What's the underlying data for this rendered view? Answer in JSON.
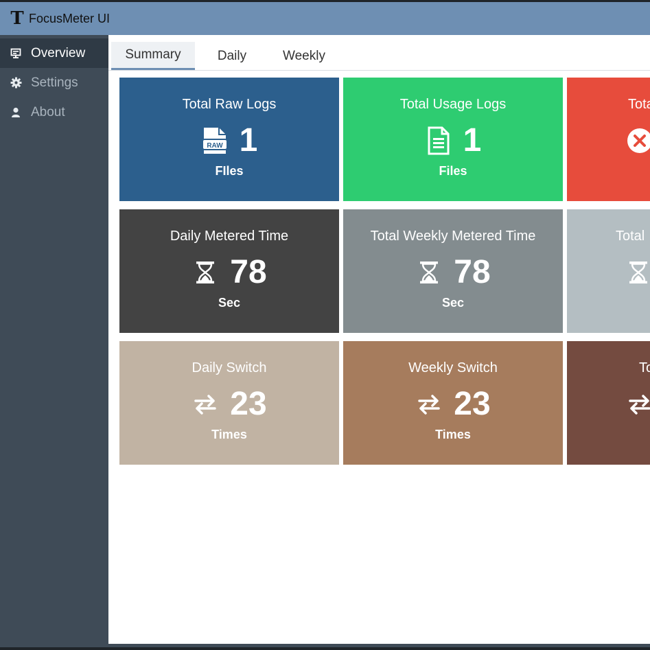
{
  "app": {
    "title": "FocusMeter UI",
    "logo_letter": "T"
  },
  "sidebar": {
    "items": [
      {
        "label": "Overview",
        "icon": "monitor-icon",
        "active": true
      },
      {
        "label": "Settings",
        "icon": "gear-icon",
        "active": false
      },
      {
        "label": "About",
        "icon": "user-icon",
        "active": false
      }
    ]
  },
  "tabs": [
    {
      "label": "Summary",
      "active": true
    },
    {
      "label": "Daily",
      "active": false
    },
    {
      "label": "Weekly",
      "active": false
    }
  ],
  "tiles": [
    {
      "title": "Total Raw Logs",
      "value": "1",
      "unit": "FIles",
      "icon": "raw-file-icon",
      "color": "#2c5f8d"
    },
    {
      "title": "Total Usage Logs",
      "value": "1",
      "unit": "Files",
      "icon": "document-icon",
      "color": "#2ecc71"
    },
    {
      "title": "Tota",
      "value": "",
      "unit": "",
      "icon": "error-circle-icon",
      "color": "#e74c3c"
    },
    {
      "title": "Daily Metered Time",
      "value": "78",
      "unit": "Sec",
      "icon": "hourglass-icon",
      "color": "#434343"
    },
    {
      "title": "Total Weekly Metered Time",
      "value": "78",
      "unit": "Sec",
      "icon": "hourglass-icon",
      "color": "#838c8f"
    },
    {
      "title": "Total",
      "value": "",
      "unit": "",
      "icon": "hourglass-icon",
      "color": "#b4bec2"
    },
    {
      "title": "Daily Switch",
      "value": "23",
      "unit": "Times",
      "icon": "switch-arrows-icon",
      "color": "#c1b3a3"
    },
    {
      "title": "Weekly Switch",
      "value": "23",
      "unit": "Times",
      "icon": "switch-arrows-icon",
      "color": "#a67c5d"
    },
    {
      "title": "To",
      "value": "",
      "unit": "",
      "icon": "switch-arrows-icon",
      "color": "#744b40"
    }
  ]
}
